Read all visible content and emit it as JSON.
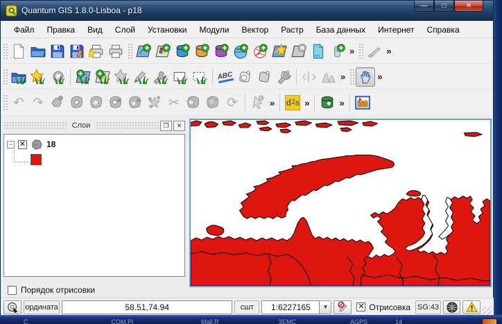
{
  "window": {
    "title": "Quantum GIS 1.8.0-Lisboa - p18",
    "minimize": "—",
    "maximize": "□",
    "close": "✕"
  },
  "menu": {
    "items": [
      "Файл",
      "Правка",
      "Вид",
      "Слой",
      "Установки",
      "Модули",
      "Вектор",
      "Растр",
      "База данных",
      "Интернет",
      "Справка"
    ]
  },
  "toolbars": {
    "overflow_label": "»",
    "labeling_label": "ABC",
    "dxf2shp_label": "d2s",
    "row1_icons": [
      "new-project",
      "open-project",
      "save-project",
      "save-project-as",
      "new-print-composer",
      "print-composer",
      "add-vector-layer",
      "add-raster-layer",
      "add-postgis-layer",
      "add-spatialite-layer",
      "add-mssql-layer",
      "add-wms-layer",
      "add-wfs-layer",
      "new-shapefile-layer",
      "remove-layer",
      "add-delimited-text-layer",
      "gps-tools",
      "measure-line"
    ],
    "row2_icons": [
      "grass-open-mapset",
      "grass-new-mapset",
      "grass-close-mapset",
      "grass-add-vector-layer",
      "grass-add-raster-layer",
      "grass-open-tools",
      "grass-edit",
      "grass-region-tools",
      "grass-display-region",
      "grass-edit-region",
      "labeling",
      "label-tag",
      "label-tag-alt",
      "label-settings",
      "raster-stretch",
      "raster-histogram",
      "pan-map"
    ],
    "row3_icons": [
      "undo",
      "redo",
      "rotate-feature",
      "simplify-feature",
      "add-ring",
      "delete-ring",
      "delete-part",
      "reshape-features",
      "split-features",
      "merge-features",
      "merge-attributes",
      "rotate-point-symbols",
      "identify",
      "dxf2shp-converter",
      "evis",
      "georeferencer"
    ]
  },
  "layers_panel": {
    "title": "Слои",
    "float_glyph": "❐",
    "close_glyph": "✕",
    "expander_glyph": "−",
    "checkbox_glyph": "✕",
    "layer_name": "18",
    "layer_color": "#dd1610",
    "draw_order_label": "Порядок отрисовки"
  },
  "map": {
    "fill_color": "#dd1610",
    "outline_color": "#000000",
    "background": "#ffffff"
  },
  "status_bar": {
    "coordinate_label": "ордината",
    "coordinate_value": "58.51,74.94",
    "scale_label": "сшт",
    "scale_value": "1:6227165",
    "dropdown_glyph": "▼",
    "render_label": "Отрисовка",
    "render_checked_glyph": "✕",
    "crs_label": "SG:43"
  },
  "background_strip": {
    "items": [
      "C",
      "COM.Pl",
      "Mail.R",
      "ЗЕМС",
      "AGPS",
      "14"
    ]
  }
}
